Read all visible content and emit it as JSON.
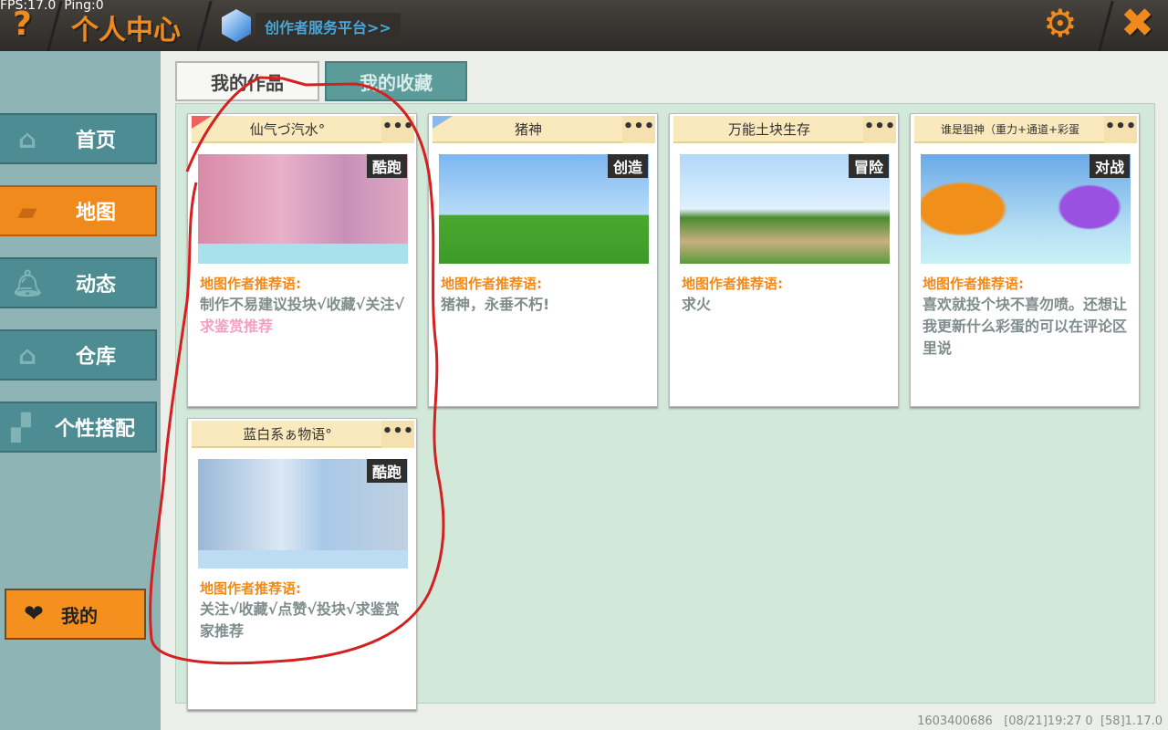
{
  "status": {
    "fps": "FPS:17.0",
    "ping": "Ping:0"
  },
  "header": {
    "help_icon": "?",
    "title": "个人中心",
    "creator_link": "创作者服务平台>>",
    "settings_icon": "gear-icon",
    "close_icon": "✖"
  },
  "sidebar": {
    "items": [
      {
        "label": "首页",
        "icon": "home-icon"
      },
      {
        "label": "地图",
        "icon": "map-icon"
      },
      {
        "label": "动态",
        "icon": "bell-icon"
      },
      {
        "label": "仓库",
        "icon": "house-icon"
      },
      {
        "label": "个性搭配",
        "icon": "outfit-icon"
      }
    ],
    "active": "地图",
    "mine_label": "我的"
  },
  "tabs": [
    {
      "label": "我的作品",
      "active": true
    },
    {
      "label": "我的收藏",
      "active": false
    }
  ],
  "recommend_label": "地图作者推荐语:",
  "more": "•••",
  "cards": [
    {
      "title": "仙气づ汽水°",
      "tag": "酷跑",
      "desc": "制作不易建议投块√收藏√关注√",
      "desc_highlight": "求鉴赏推荐"
    },
    {
      "title": "猪神",
      "tag": "创造",
      "desc": "猪神，永垂不朽!"
    },
    {
      "title": "万能土块生存",
      "tag": "冒险",
      "desc": "求火"
    },
    {
      "title": "谁是狙神（重力+通道+彩蛋",
      "tag": "对战",
      "desc": "喜欢就投个块不喜勿喷。还想让我更新什么彩蛋的可以在评论区里说"
    },
    {
      "title": "蓝白系ぁ物语°",
      "tag": "酷跑",
      "desc": "关注√收藏√点赞√投块√求鉴赏家推荐"
    }
  ],
  "footer": {
    "uid": "1603400686",
    "time": "[08/21]19:27 0",
    "version": "[58]1.17.0"
  },
  "colors": {
    "accent": "#f08a1c",
    "sidebar": "#8fb4b5",
    "annotation": "#d42020"
  }
}
